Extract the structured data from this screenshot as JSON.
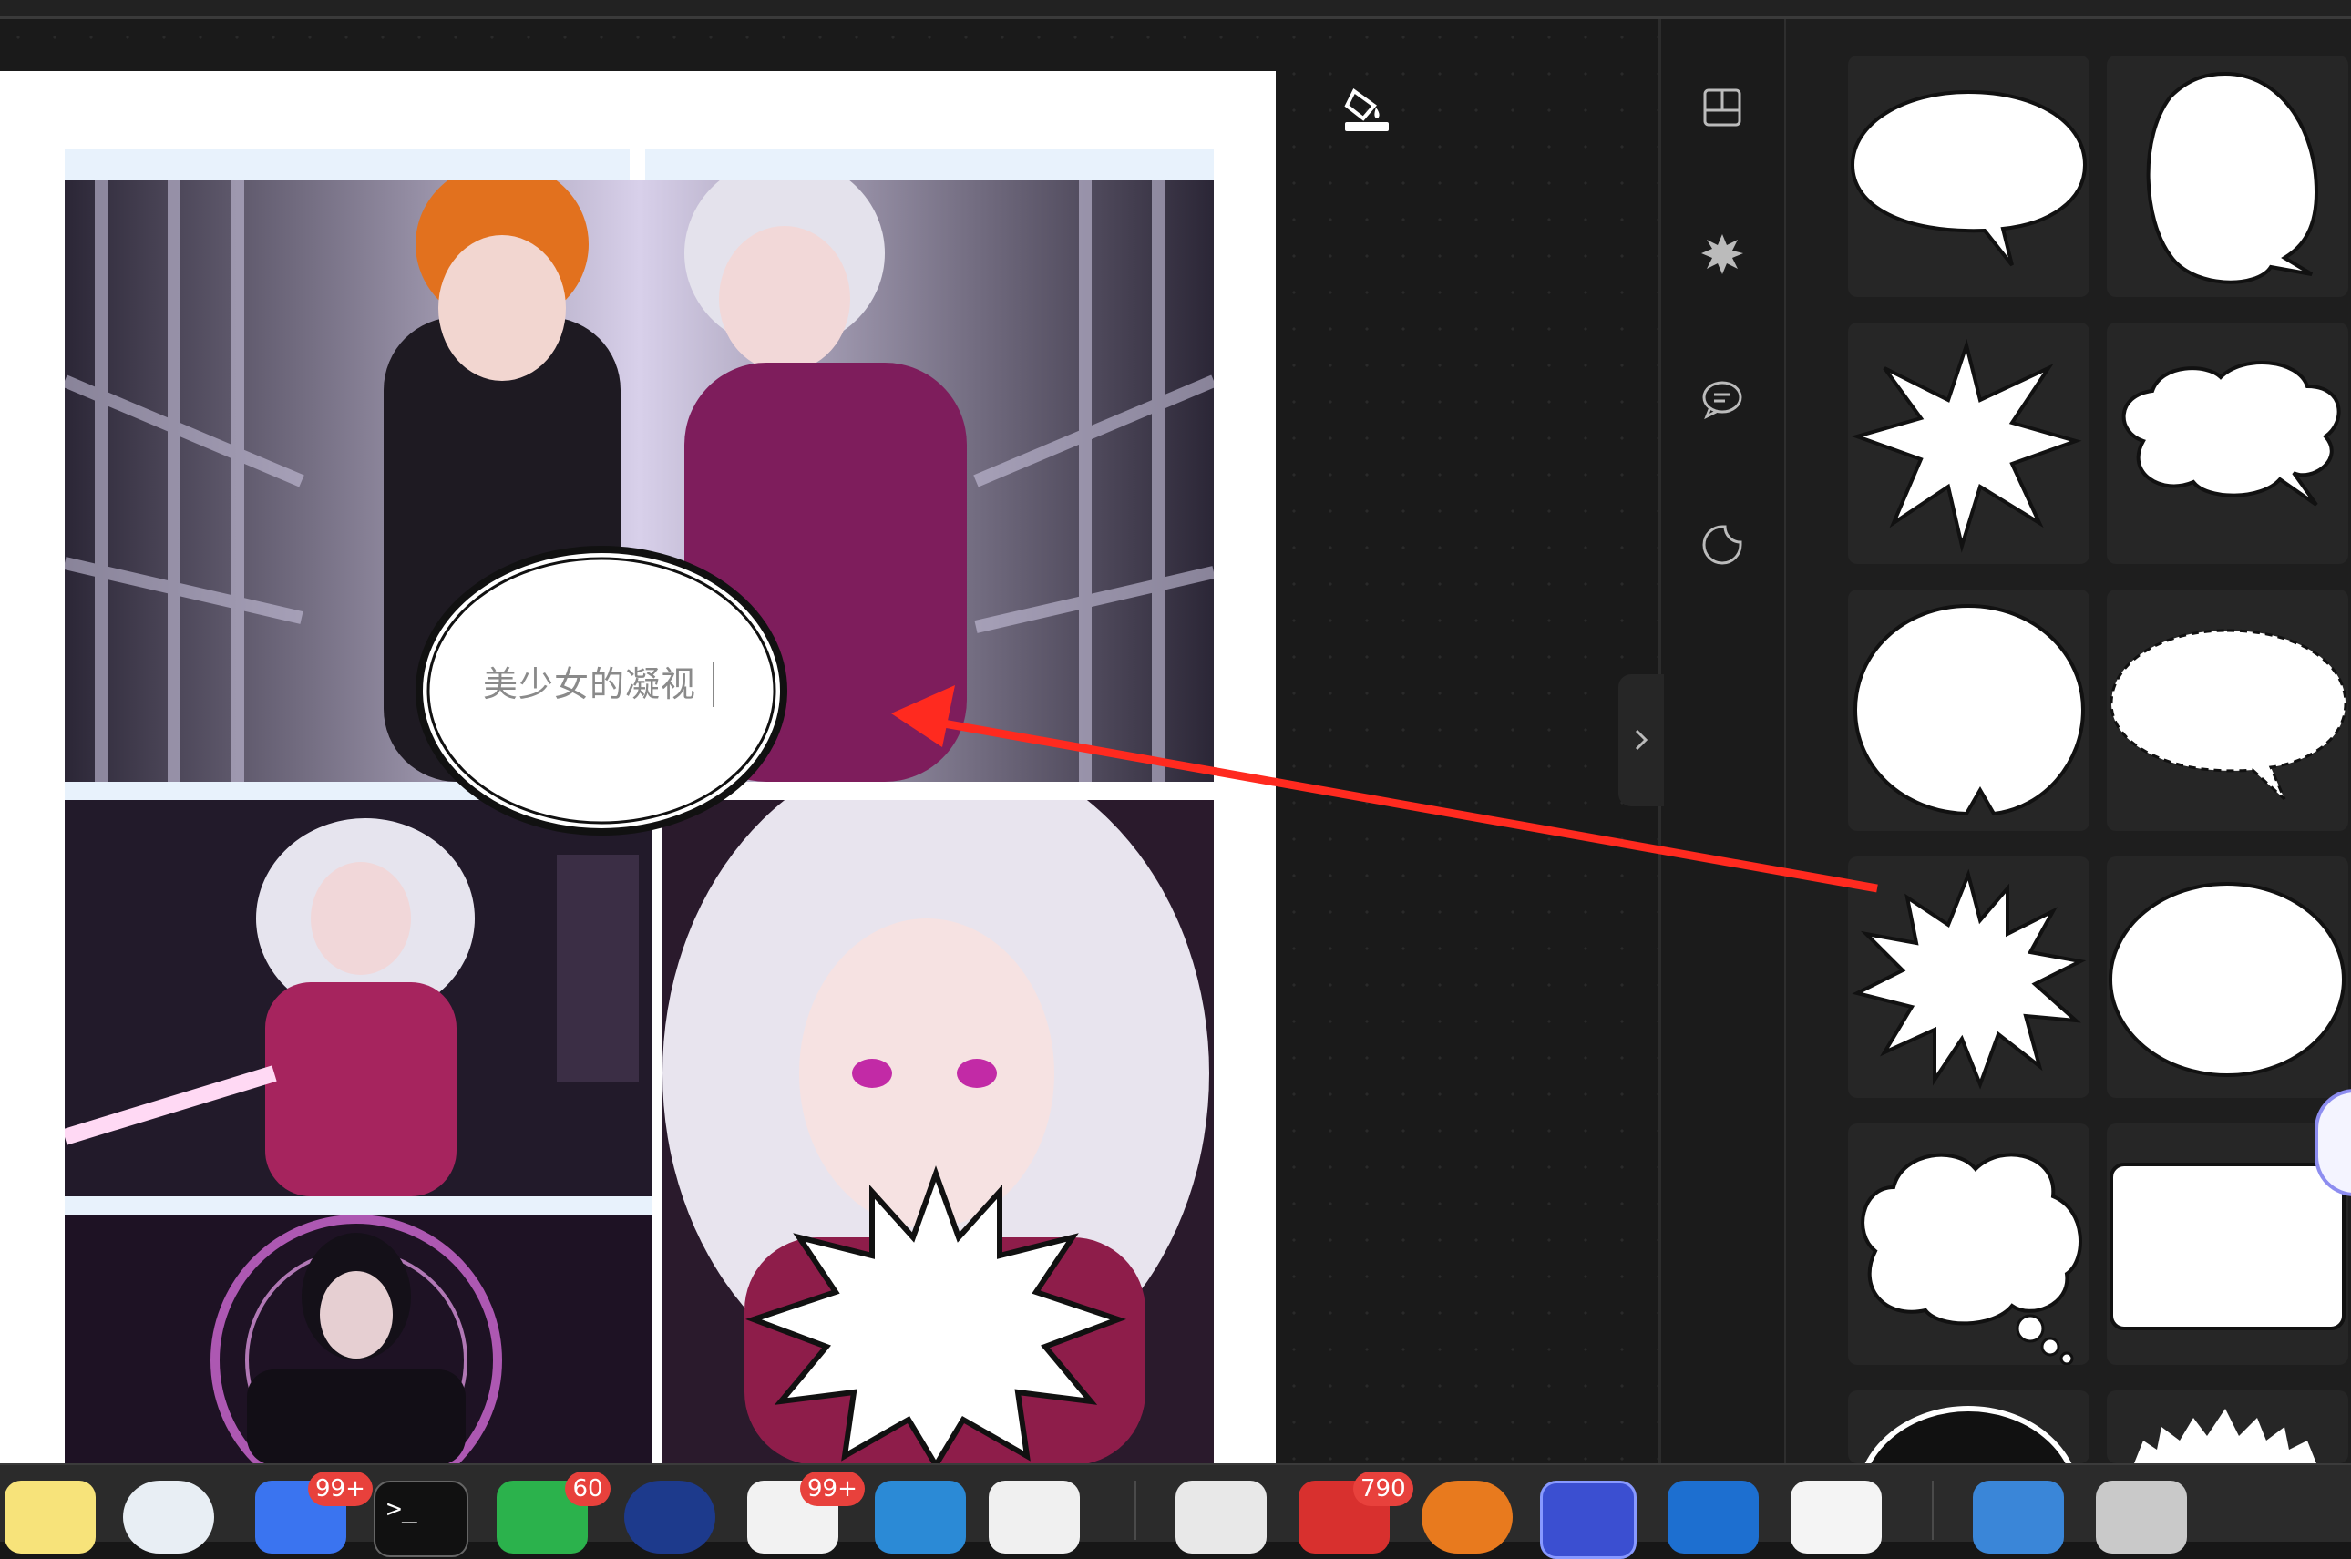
{
  "canvas": {
    "speech_bubble_text": "美少女的凝视"
  },
  "toolbar": {
    "tools": [
      "layout-icon",
      "burst-icon",
      "chat-bubble-icon",
      "sticker-icon"
    ]
  },
  "bubble_library": {
    "items": [
      "oval-speech-bubble",
      "tall-oval-speech-bubble",
      "spiky-burst-bubble",
      "cloud-speech-bubble",
      "round-speech-bubble",
      "dashed-oval-bubble",
      "starburst-bubble",
      "plain-oval-bubble",
      "thought-cloud-bubble",
      "rounded-rectangle-bubble",
      "black-oval-bubble",
      "flash-burst-bubble"
    ]
  },
  "dock": {
    "apps": [
      {
        "name": "notes-icon"
      },
      {
        "name": "android-studio-icon"
      },
      {
        "name": "feishu-icon",
        "badge": "99+"
      },
      {
        "name": "terminal-icon"
      },
      {
        "name": "wechat-icon",
        "badge": "60"
      },
      {
        "name": "teamviewer-icon"
      },
      {
        "name": "qq-icon",
        "badge": "99+"
      },
      {
        "name": "vscode-icon"
      },
      {
        "name": "typora-icon"
      },
      {
        "name": "pages-icon"
      },
      {
        "name": "wps-icon",
        "badge": "790"
      },
      {
        "name": "blender-icon"
      },
      {
        "name": "app-f-icon"
      },
      {
        "name": "rocket-icon"
      },
      {
        "name": "cloud-drive-icon"
      },
      {
        "name": "downloads-icon"
      },
      {
        "name": "trash-icon"
      }
    ]
  },
  "colors": {
    "annotation_arrow": "#ff2a1f",
    "badge": "#e8413c",
    "panel_bg": "#1e1e1e"
  }
}
